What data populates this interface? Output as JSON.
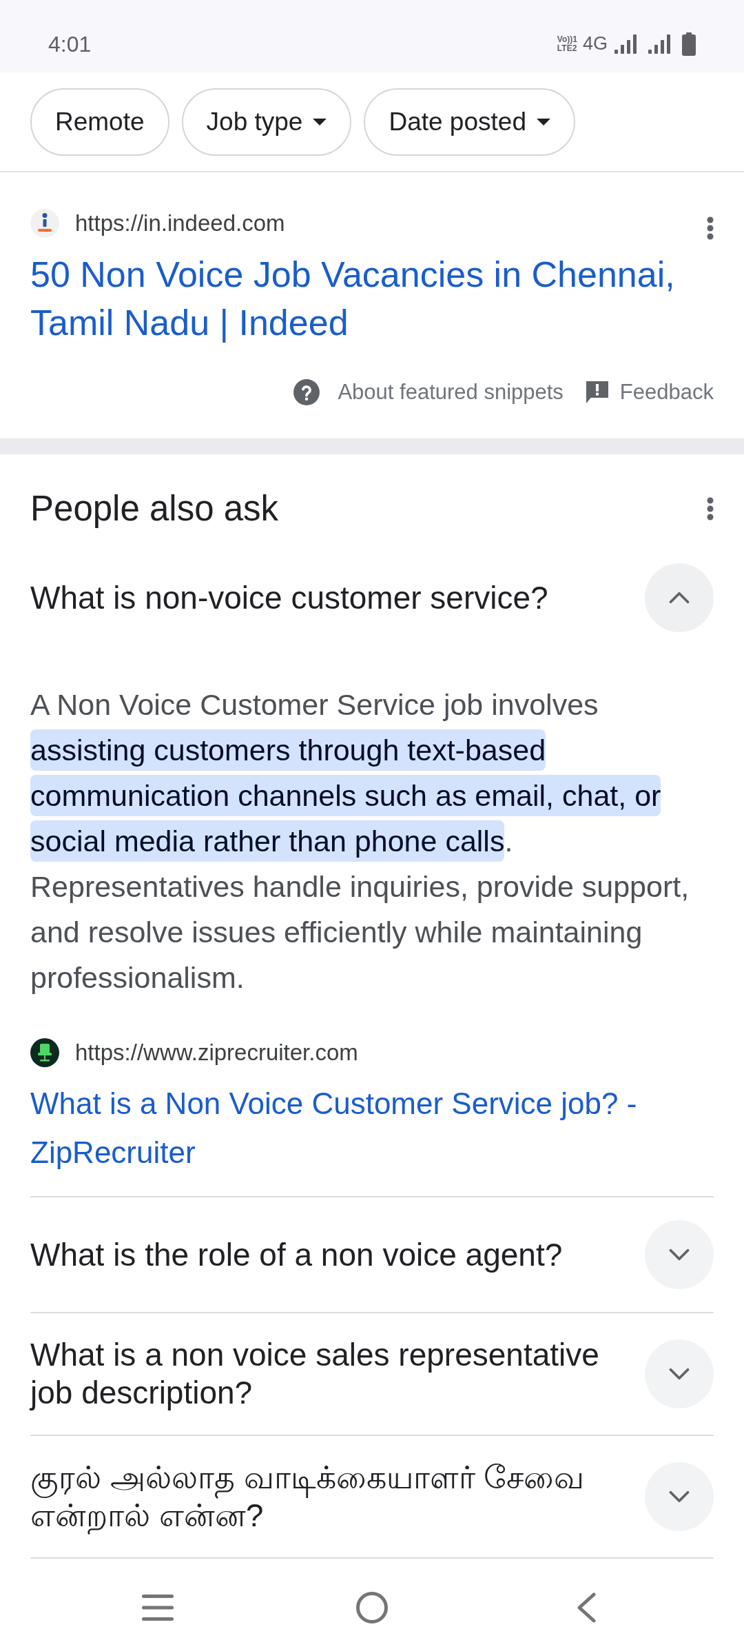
{
  "status_bar": {
    "time": "4:01",
    "volte": [
      "Vo))1",
      "LTE2"
    ],
    "network": "4G"
  },
  "filter_chips": [
    {
      "label": "Remote",
      "dropdown": false
    },
    {
      "label": "Job type",
      "dropdown": true
    },
    {
      "label": "Date posted",
      "dropdown": true
    }
  ],
  "featured_result": {
    "url": "https://in.indeed.com",
    "title": "50 Non Voice Job Vacancies in Chennai, Tamil Nadu | Indeed",
    "about_link": "About featured snippets",
    "feedback_link": "Feedback"
  },
  "people_also_ask": {
    "title": "People also ask",
    "questions": [
      {
        "question": "What is non-voice customer service?",
        "expanded": true,
        "answer": {
          "before": "A Non Voice Customer Service job involves ",
          "highlight": "assisting customers through text-based communication channels such as email, chat, or social media rather than phone calls",
          "after": ". Representatives handle inquiries, provide support, and resolve issues efficiently while maintaining professionalism."
        },
        "source": {
          "url": "https://www.ziprecruiter.com",
          "title": "What is a Non Voice Customer Service job? - ZipRecruiter"
        }
      },
      {
        "question": "What is the role of a non voice agent?",
        "expanded": false
      },
      {
        "question": "What is a non voice sales representative job description?",
        "expanded": false
      },
      {
        "question": "குரல் அல்லாத வாடிக்கையாளர் சேவை என்றால் என்ன?",
        "expanded": false
      }
    ]
  }
}
